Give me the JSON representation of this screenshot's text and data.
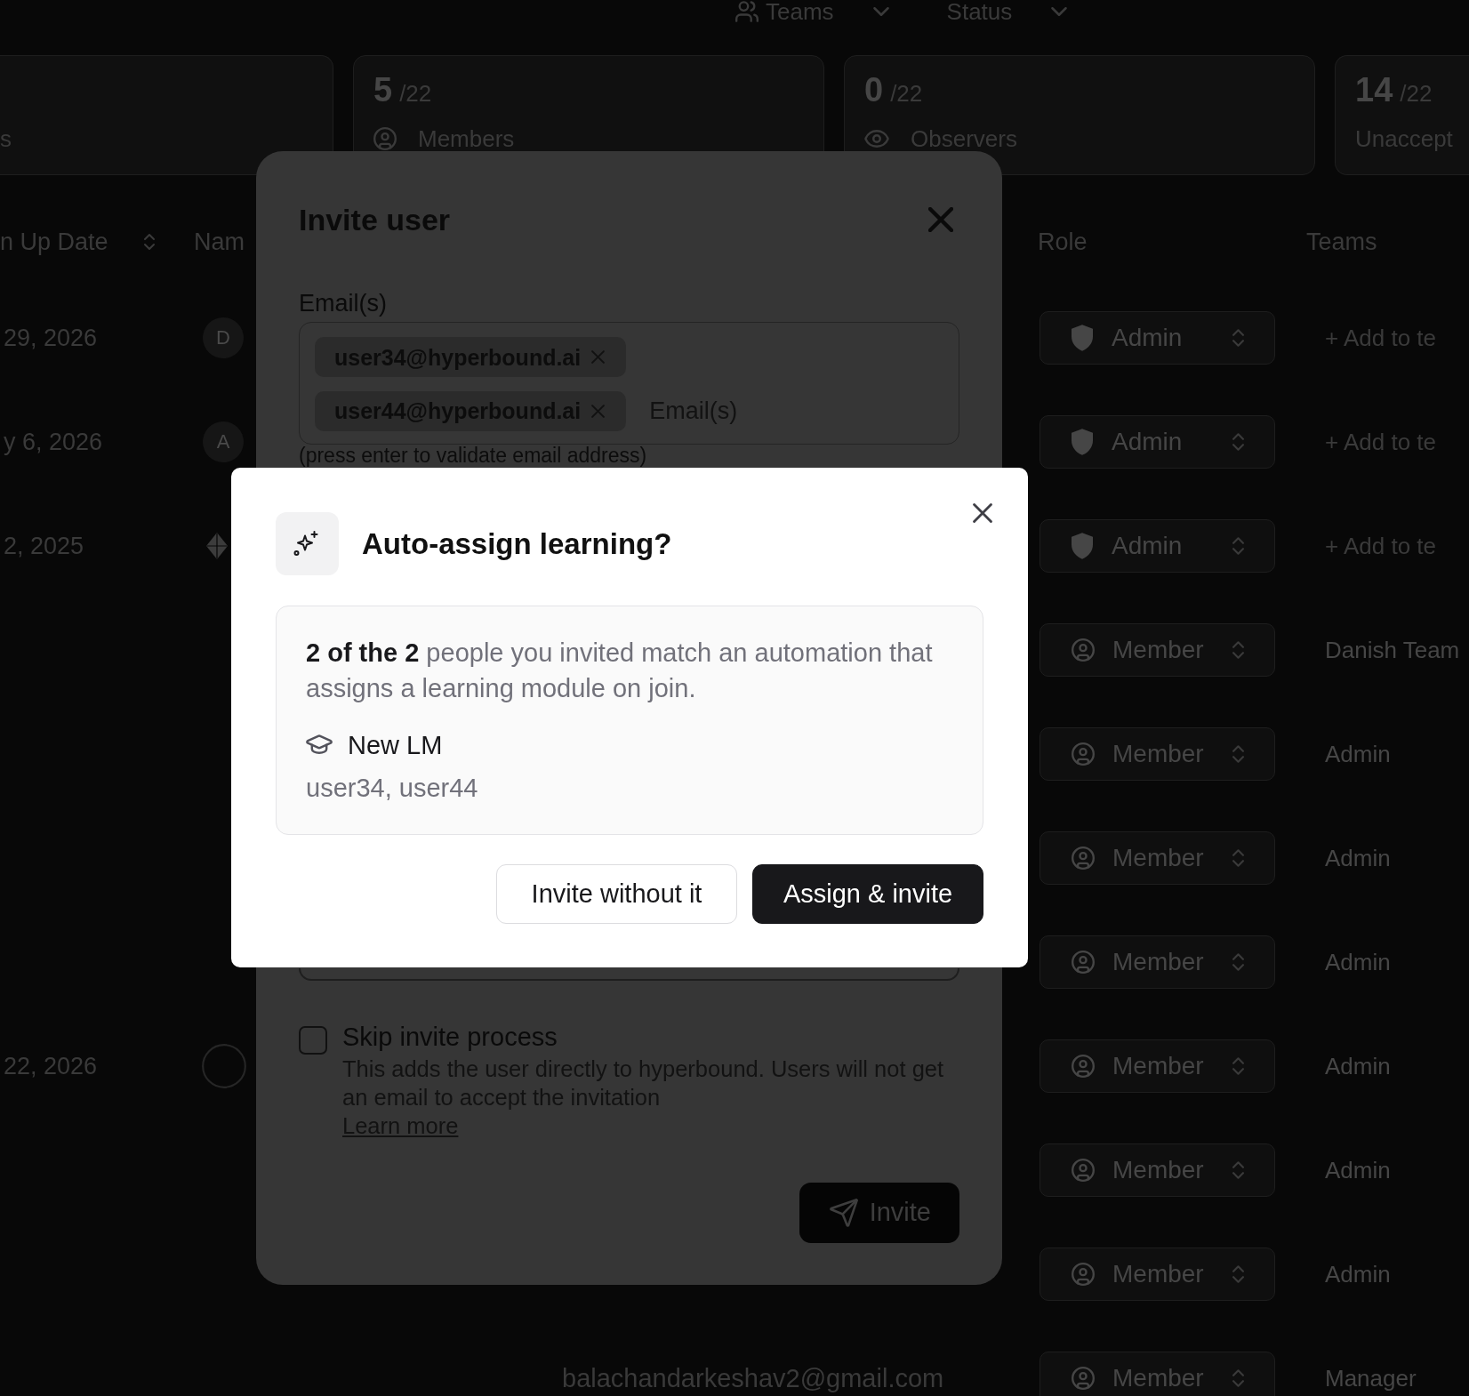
{
  "filters": [
    {
      "kind": "teams",
      "label": "Teams"
    },
    {
      "kind": "status",
      "label": "Status"
    }
  ],
  "stats": [
    {
      "kind": "plain",
      "label": "s"
    },
    {
      "kind": "members",
      "value": "5",
      "total": "/22",
      "label": "Members"
    },
    {
      "kind": "observers",
      "value": "0",
      "total": "/22",
      "label": "Observers"
    },
    {
      "kind": "plain",
      "value": "14",
      "total": "/22",
      "label": "Unaccept"
    }
  ],
  "table": {
    "columns": [
      {
        "label": "n Up Date",
        "sortable": true
      },
      {
        "label": "Nam",
        "sortable": false
      },
      {
        "label": "Role",
        "sortable": false
      },
      {
        "label": "Teams",
        "sortable": false
      }
    ],
    "rows": [
      {
        "date": "29, 2026",
        "avatar": {
          "kind": "letter",
          "letter": "D"
        },
        "role": {
          "kind": "admin",
          "label": "Admin"
        },
        "team": {
          "kind": "add",
          "label": "+ Add to te"
        }
      },
      {
        "date": "y 6, 2026",
        "avatar": {
          "kind": "letter",
          "letter": "A"
        },
        "role": {
          "kind": "admin",
          "label": "Admin"
        },
        "team": {
          "kind": "add",
          "label": "+ Add to te"
        }
      },
      {
        "date": "2, 2025",
        "avatar": {
          "kind": "logo"
        },
        "role": {
          "kind": "admin",
          "label": "Admin"
        },
        "team": {
          "kind": "add",
          "label": "+ Add to te"
        }
      },
      {
        "role": {
          "kind": "member",
          "label": "Member"
        },
        "team": {
          "kind": "team",
          "label": "Danish Team"
        }
      },
      {
        "role": {
          "kind": "member",
          "label": "Member"
        },
        "team": {
          "kind": "team",
          "label": "Admin"
        }
      },
      {
        "role": {
          "kind": "member",
          "label": "Member"
        },
        "team": {
          "kind": "team",
          "label": "Admin"
        }
      },
      {
        "role": {
          "kind": "member",
          "label": "Member"
        },
        "team": {
          "kind": "team",
          "label": "Admin"
        }
      },
      {
        "date": "22, 2026",
        "avatar": {
          "kind": "blank"
        },
        "role": {
          "kind": "member",
          "label": "Member"
        },
        "team": {
          "kind": "team",
          "label": "Admin"
        }
      },
      {
        "role": {
          "kind": "member",
          "label": "Member"
        },
        "team": {
          "kind": "team",
          "label": "Admin"
        }
      },
      {
        "role": {
          "kind": "member",
          "label": "Member"
        },
        "team": {
          "kind": "team",
          "label": "Admin"
        }
      },
      {
        "email": "balachandarkeshav2@gmail.com",
        "role": {
          "kind": "member",
          "label": "Member"
        },
        "team": {
          "kind": "team",
          "label": "Manager"
        }
      }
    ]
  },
  "invite_modal": {
    "title": "Invite user",
    "email_label": "Email(s)",
    "emails": [
      "user34@hyperbound.ai",
      "user44@hyperbound.ai"
    ],
    "email_placeholder": "Email(s)",
    "hint": "(press enter to validate email address)",
    "skip": {
      "label": "Skip invite process",
      "checked": false,
      "description": "This adds the user directly to hyperbound. Users will not get an email to accept the invitation",
      "link": "Learn more"
    },
    "submit": "Invite"
  },
  "dialog": {
    "title": "Auto-assign learning?",
    "message": "**2 of the 2** people you invited match an automation that assigns a learning module on join.",
    "module": "New LM",
    "users": "user34, user44",
    "buttons": [
      {
        "kind": "secondary",
        "label": "Invite without it"
      },
      {
        "kind": "primary",
        "label": "Assign & invite"
      }
    ]
  }
}
